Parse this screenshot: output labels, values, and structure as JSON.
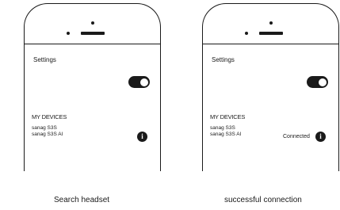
{
  "screens": [
    {
      "settings_title": "Settings",
      "section_heading": "MY DEVICES",
      "devices": [
        "sanag S3S",
        "sanag S3S AI"
      ],
      "info_icon": "info-icon",
      "status": "",
      "caption": "Search headset"
    },
    {
      "settings_title": "Settings",
      "section_heading": "MY DEVICES",
      "devices": [
        "sanag S3S",
        "sanag S3S AI"
      ],
      "info_icon": "info-icon",
      "status": "Connected",
      "caption": "successful connection"
    }
  ]
}
